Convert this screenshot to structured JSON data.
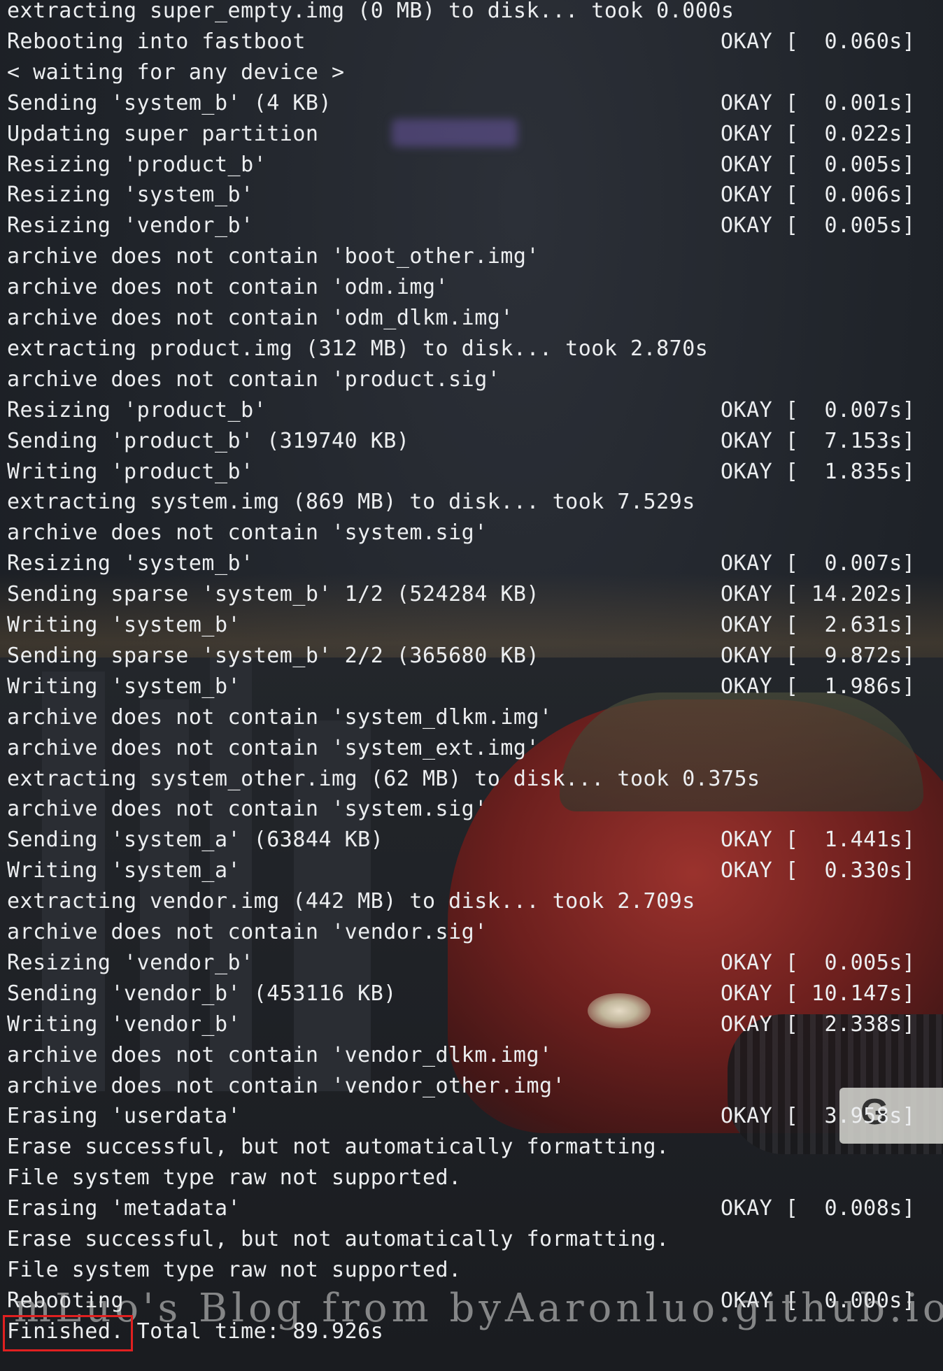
{
  "terminal": {
    "lines": [
      {
        "text": "extracting super_empty.img (0 MB) to disk... took 0.000s",
        "status": ""
      },
      {
        "text": "Rebooting into fastboot",
        "status": "OKAY [  0.060s]"
      },
      {
        "text": "< waiting for any device >",
        "status": ""
      },
      {
        "text": "Sending 'system_b' (4 KB)",
        "status": "OKAY [  0.001s]"
      },
      {
        "text": "Updating super partition",
        "status": "OKAY [  0.022s]"
      },
      {
        "text": "Resizing 'product_b'",
        "status": "OKAY [  0.005s]"
      },
      {
        "text": "Resizing 'system_b'",
        "status": "OKAY [  0.006s]"
      },
      {
        "text": "Resizing 'vendor_b'",
        "status": "OKAY [  0.005s]"
      },
      {
        "text": "archive does not contain 'boot_other.img'",
        "status": ""
      },
      {
        "text": "archive does not contain 'odm.img'",
        "status": ""
      },
      {
        "text": "archive does not contain 'odm_dlkm.img'",
        "status": ""
      },
      {
        "text": "extracting product.img (312 MB) to disk... took 2.870s",
        "status": ""
      },
      {
        "text": "archive does not contain 'product.sig'",
        "status": ""
      },
      {
        "text": "Resizing 'product_b'",
        "status": "OKAY [  0.007s]"
      },
      {
        "text": "Sending 'product_b' (319740 KB)",
        "status": "OKAY [  7.153s]"
      },
      {
        "text": "Writing 'product_b'",
        "status": "OKAY [  1.835s]"
      },
      {
        "text": "extracting system.img (869 MB) to disk... took 7.529s",
        "status": ""
      },
      {
        "text": "archive does not contain 'system.sig'",
        "status": ""
      },
      {
        "text": "Resizing 'system_b'",
        "status": "OKAY [  0.007s]"
      },
      {
        "text": "Sending sparse 'system_b' 1/2 (524284 KB)",
        "status": "OKAY [ 14.202s]"
      },
      {
        "text": "Writing 'system_b'",
        "status": "OKAY [  2.631s]"
      },
      {
        "text": "Sending sparse 'system_b' 2/2 (365680 KB)",
        "status": "OKAY [  9.872s]"
      },
      {
        "text": "Writing 'system_b'",
        "status": "OKAY [  1.986s]"
      },
      {
        "text": "archive does not contain 'system_dlkm.img'",
        "status": ""
      },
      {
        "text": "archive does not contain 'system_ext.img'",
        "status": ""
      },
      {
        "text": "extracting system_other.img (62 MB) to disk... took 0.375s",
        "status": ""
      },
      {
        "text": "archive does not contain 'system.sig'",
        "status": ""
      },
      {
        "text": "Sending 'system_a' (63844 KB)",
        "status": "OKAY [  1.441s]"
      },
      {
        "text": "Writing 'system_a'",
        "status": "OKAY [  0.330s]"
      },
      {
        "text": "extracting vendor.img (442 MB) to disk... took 2.709s",
        "status": ""
      },
      {
        "text": "archive does not contain 'vendor.sig'",
        "status": ""
      },
      {
        "text": "Resizing 'vendor_b'",
        "status": "OKAY [  0.005s]"
      },
      {
        "text": "Sending 'vendor_b' (453116 KB)",
        "status": "OKAY [ 10.147s]"
      },
      {
        "text": "Writing 'vendor_b'",
        "status": "OKAY [  2.338s]"
      },
      {
        "text": "archive does not contain 'vendor_dlkm.img'",
        "status": ""
      },
      {
        "text": "archive does not contain 'vendor_other.img'",
        "status": ""
      },
      {
        "text": "Erasing 'userdata'",
        "status": "OKAY [  3.958s]"
      },
      {
        "text": "Erase successful, but not automatically formatting.",
        "status": ""
      },
      {
        "text": "File system type raw not supported.",
        "status": ""
      },
      {
        "text": "Erasing 'metadata'",
        "status": "OKAY [  0.008s]"
      },
      {
        "text": "Erase successful, but not automatically formatting.",
        "status": ""
      },
      {
        "text": "File system type raw not supported.",
        "status": ""
      },
      {
        "text": "Rebooting",
        "status": "OKAY [  0.000s]"
      },
      {
        "text": "Finished. Total time: 89.926s",
        "status": ""
      }
    ]
  },
  "watermark": "mLuo's Blog from byAaronluo.github.io",
  "plate_text": "G",
  "colors": {
    "text": "#eceef0",
    "background": "#1f2329",
    "highlight": "#e02020"
  }
}
